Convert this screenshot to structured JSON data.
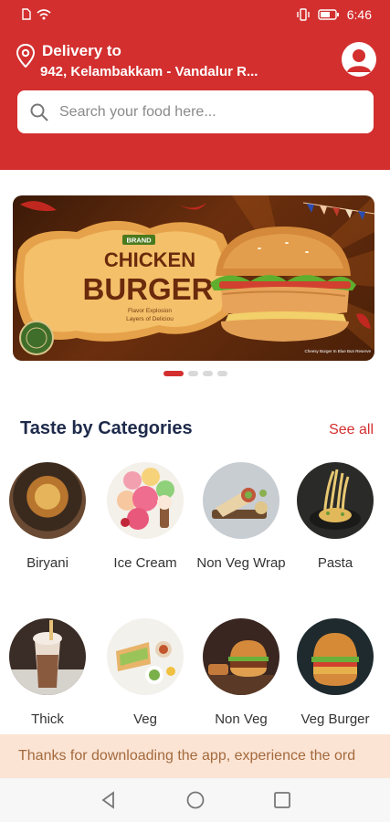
{
  "status_bar": {
    "time": "6:46"
  },
  "header": {
    "delivery_label": "Delivery to",
    "address": "942, Kelambakkam - Vandalur R...",
    "search_placeholder": "Search your food here..."
  },
  "banner": {
    "brand_tag": "BRAND",
    "line1": "CHICKEN",
    "line2": "BURGER",
    "tagline1": "Flavor Explosion",
    "tagline2": "Layers of Deliciou",
    "caption": "Cheesy Burger In Blue Bun Reserve",
    "active_slide": 1,
    "slide_count": 4
  },
  "categories_section": {
    "title": "Taste by Categories",
    "see_all": "See all",
    "items": [
      {
        "label": "Biryani"
      },
      {
        "label": "Ice Cream"
      },
      {
        "label": "Non Veg Wrap"
      },
      {
        "label": "Pasta"
      },
      {
        "label": "Thick"
      },
      {
        "label": "Veg"
      },
      {
        "label": "Non Veg"
      },
      {
        "label": "Veg Burger"
      }
    ]
  },
  "toast": {
    "message": "Thanks for downloading the app, experience the ord"
  },
  "colors": {
    "primary": "#d32f2f",
    "toast_bg": "#fbe4d4",
    "heading": "#1e2a4a"
  }
}
